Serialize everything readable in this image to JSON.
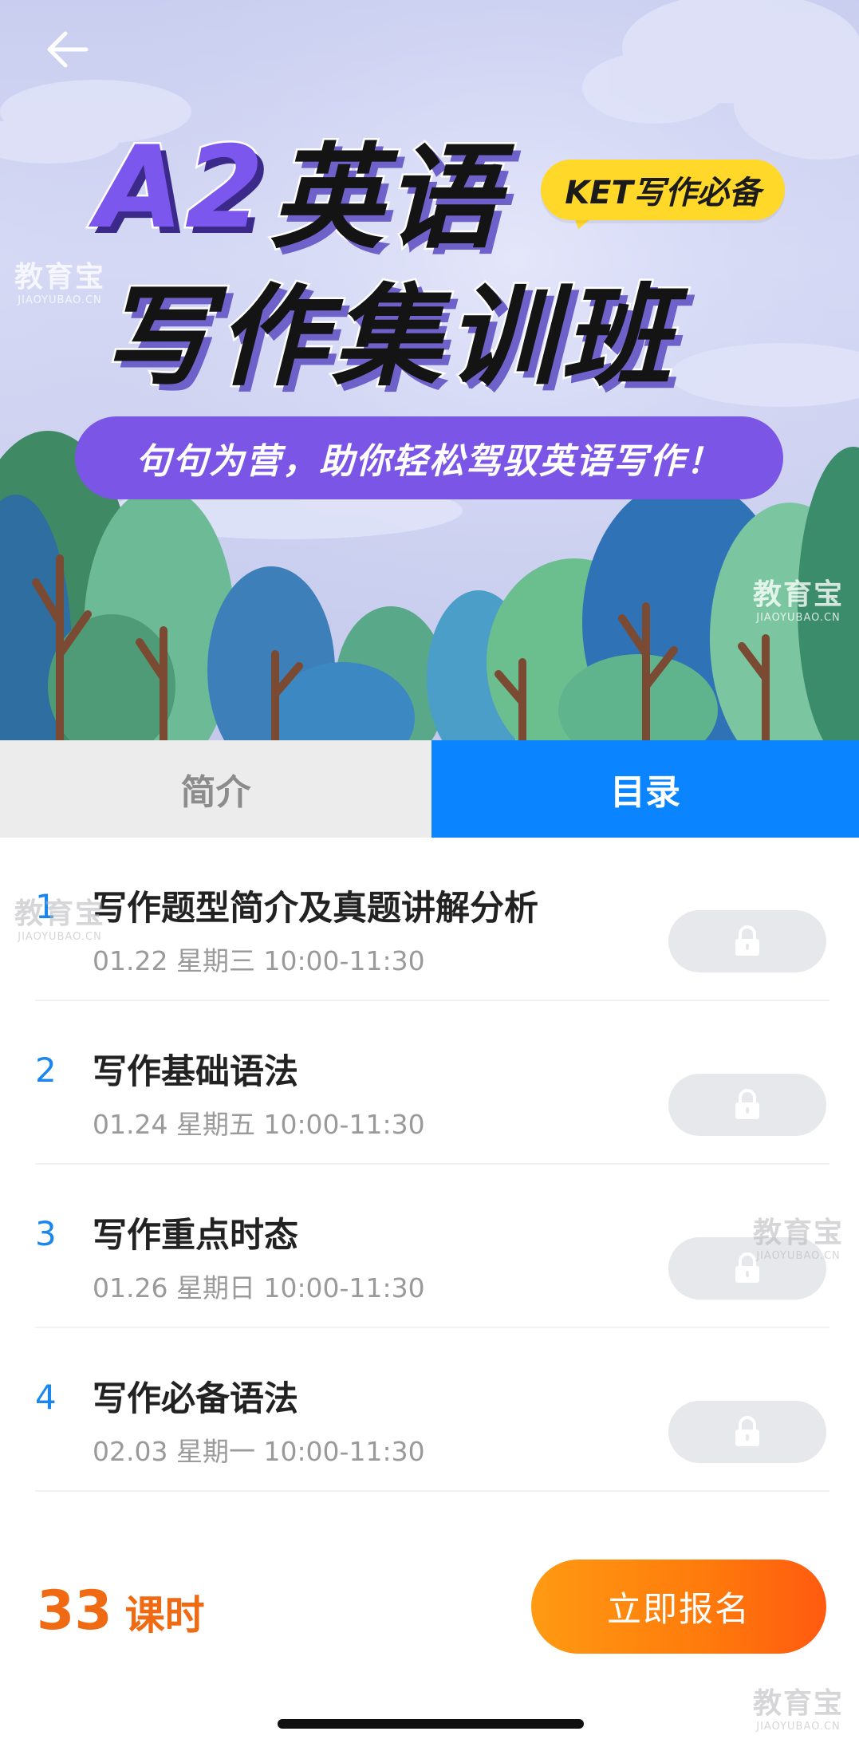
{
  "banner": {
    "title_a2": "A2",
    "title_english": "英语",
    "badge": "KET写作必备",
    "title_line2": "写作集训班",
    "slogan": "句句为营，助你轻松驾驭英语写作！"
  },
  "watermark": {
    "cn": "教育宝",
    "en": "JIAOYUBAO.CN"
  },
  "tabs": [
    {
      "label": "简介",
      "active": false
    },
    {
      "label": "目录",
      "active": true
    }
  ],
  "lessons": [
    {
      "num": "1",
      "title": "写作题型简介及真题讲解分析",
      "time": "01.22  星期三 10:00-11:30",
      "locked": true
    },
    {
      "num": "2",
      "title": "写作基础语法",
      "time": "01.24  星期五 10:00-11:30",
      "locked": true
    },
    {
      "num": "3",
      "title": "写作重点时态",
      "time": "01.26  星期日 10:00-11:30",
      "locked": true
    },
    {
      "num": "4",
      "title": "写作必备语法",
      "time": "02.03  星期一 10:00-11:30",
      "locked": true
    }
  ],
  "footer": {
    "hours_count": "33",
    "hours_unit": "课时",
    "enroll_label": "立即报名"
  },
  "colors": {
    "accent_blue": "#0a84ff",
    "accent_orange": "#ff7a0c",
    "banner_purple": "#7a55e6",
    "badge_yellow": "#ffd82a"
  },
  "icons": {
    "back": "arrow-left-icon",
    "lock": "lock-icon"
  }
}
